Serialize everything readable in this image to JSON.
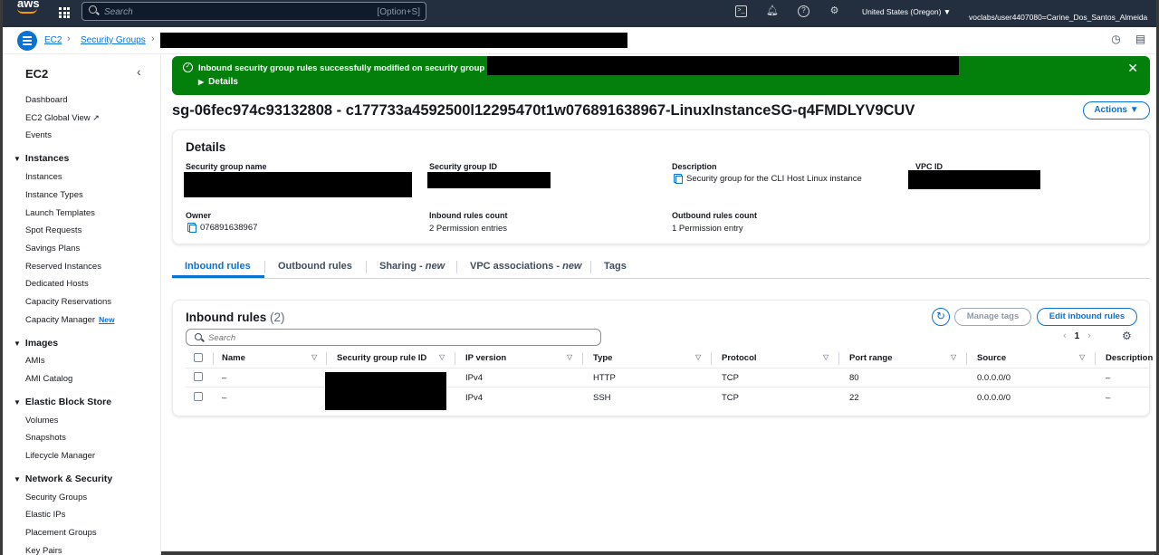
{
  "topnav": {
    "logo": "aws",
    "search_placeholder": "Search",
    "search_shortcut": "[Option+S]",
    "region": "United States (Oregon) ▼",
    "user": "voclabs/user4407080=Carine_Dos_Santos_Almeida"
  },
  "breadcrumb": {
    "items": [
      "EC2",
      "Security Groups"
    ]
  },
  "sidebar": {
    "title": "EC2",
    "top_items": [
      "Dashboard",
      "EC2 Global View",
      "Events"
    ],
    "sections": [
      {
        "title": "Instances",
        "items": [
          "Instances",
          "Instance Types",
          "Launch Templates",
          "Spot Requests",
          "Savings Plans",
          "Reserved Instances",
          "Dedicated Hosts",
          "Capacity Reservations",
          "Capacity Manager"
        ]
      },
      {
        "title": "Images",
        "items": [
          "AMIs",
          "AMI Catalog"
        ]
      },
      {
        "title": "Elastic Block Store",
        "items": [
          "Volumes",
          "Snapshots",
          "Lifecycle Manager"
        ]
      },
      {
        "title": "Network & Security",
        "items": [
          "Security Groups",
          "Elastic IPs",
          "Placement Groups",
          "Key Pairs"
        ]
      }
    ],
    "new_badge": "New"
  },
  "flash": {
    "message": "Inbound security group rules successfully modified on security group",
    "details_label": "Details"
  },
  "page": {
    "title": "sg-06fec974c93132808 - c177733a4592500l12295470t1w076891638967-LinuxInstanceSG-q4FMDLYV9CUV",
    "actions_label": "Actions ▼"
  },
  "details": {
    "heading": "Details",
    "fields": {
      "sg_name_label": "Security group name",
      "sg_id_label": "Security group ID",
      "description_label": "Description",
      "description_value": "Security group for the CLI Host Linux instance",
      "vpc_id_label": "VPC ID",
      "owner_label": "Owner",
      "owner_value": "076891638967",
      "inbound_count_label": "Inbound rules count",
      "inbound_count_value": "2 Permission entries",
      "outbound_count_label": "Outbound rules count",
      "outbound_count_value": "1 Permission entry"
    }
  },
  "tabs": {
    "inbound": "Inbound rules",
    "outbound": "Outbound rules",
    "sharing": "Sharing - ",
    "sharing_new": "new",
    "vpc_assoc": "VPC associations - ",
    "vpc_assoc_new": "new",
    "tags": "Tags"
  },
  "rules": {
    "heading": "Inbound rules",
    "count": "(2)",
    "manage_tags": "Manage tags",
    "edit_rules": "Edit inbound rules",
    "search_placeholder": "Search",
    "page": "1",
    "columns": [
      "Name",
      "Security group rule ID",
      "IP version",
      "Type",
      "Protocol",
      "Port range",
      "Source",
      "Description"
    ],
    "rows": [
      {
        "name": "–",
        "ip_version": "IPv4",
        "type": "HTTP",
        "protocol": "TCP",
        "port_range": "80",
        "source": "0.0.0.0/0",
        "description": "–"
      },
      {
        "name": "–",
        "ip_version": "IPv4",
        "type": "SSH",
        "protocol": "TCP",
        "port_range": "22",
        "source": "0.0.0.0/0",
        "description": "–"
      }
    ]
  },
  "colors": {
    "nav_bg": "#232f3e",
    "link_blue": "#0972d3",
    "success_green": "#037f0c"
  }
}
